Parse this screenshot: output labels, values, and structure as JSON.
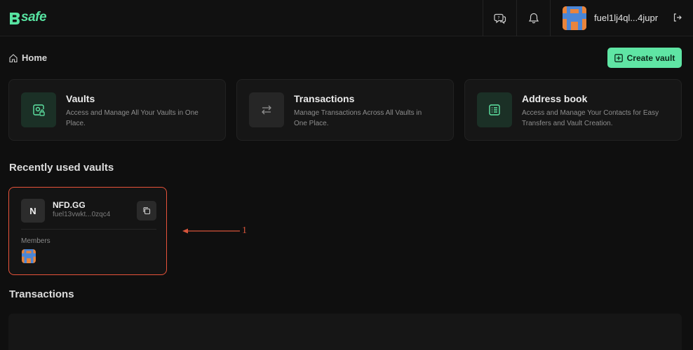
{
  "header": {
    "logo_text": "safe",
    "help_icon": "help-chat-icon",
    "notification_icon": "bell-icon",
    "user_name": "fuel1lj4ql...4jupr",
    "logout_icon": "logout-icon"
  },
  "breadcrumb": {
    "home_label": "Home"
  },
  "create_vault": {
    "label": "Create vault"
  },
  "cards": [
    {
      "title": "Vaults",
      "description": "Access and Manage All Your Vaults in One Place.",
      "icon": "vault-icon"
    },
    {
      "title": "Transactions",
      "description": "Manage Transactions Across All Vaults in One Place.",
      "icon": "transfer-icon"
    },
    {
      "title": "Address book",
      "description": "Access and Manage Your Contacts for Easy Transfers and Vault Creation.",
      "icon": "list-icon"
    }
  ],
  "recent": {
    "title": "Recently used vaults",
    "vault": {
      "initial": "N",
      "name": "NFD.GG",
      "address": "fuel13vwkt...0zqc4",
      "members_label": "Members"
    }
  },
  "annotation": {
    "number": "1"
  },
  "transactions": {
    "title": "Transactions"
  },
  "colors": {
    "accent": "#5fe5a4",
    "highlight": "#e8533a",
    "background": "#0f0f0f"
  }
}
